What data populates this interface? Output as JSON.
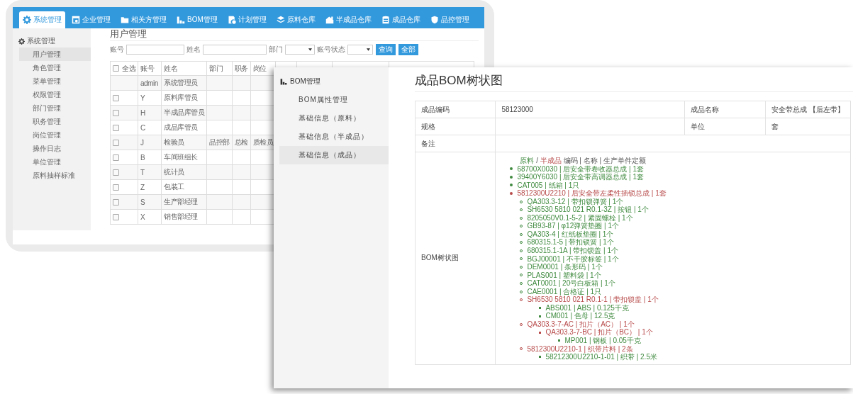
{
  "back_window": {
    "nav_tabs": [
      {
        "label": "系统管理",
        "selected": true
      },
      {
        "label": "企业管理",
        "selected": false
      },
      {
        "label": "相关方管理",
        "selected": false
      },
      {
        "label": "BOM管理",
        "selected": false
      },
      {
        "label": "计划管理",
        "selected": false
      },
      {
        "label": "原料仓库",
        "selected": false
      },
      {
        "label": "半成品仓库",
        "selected": false
      },
      {
        "label": "成品仓库",
        "selected": false
      },
      {
        "label": "品控管理",
        "selected": false
      }
    ],
    "sidebar": {
      "title": "系统管理",
      "items": [
        {
          "label": "用户管理",
          "selected": true
        },
        {
          "label": "角色管理",
          "selected": false
        },
        {
          "label": "菜单管理",
          "selected": false
        },
        {
          "label": "权限管理",
          "selected": false
        },
        {
          "label": "部门管理",
          "selected": false
        },
        {
          "label": "职务管理",
          "selected": false
        },
        {
          "label": "岗位管理",
          "selected": false
        },
        {
          "label": "操作日志",
          "selected": false
        },
        {
          "label": "单位管理",
          "selected": false
        },
        {
          "label": "原料抽样标准",
          "selected": false
        }
      ]
    },
    "page_title": "用户管理",
    "filters": [
      {
        "label": "账号",
        "kind": "text"
      },
      {
        "label": "姓名",
        "kind": "text"
      },
      {
        "label": "部门",
        "kind": "select"
      },
      {
        "label": "账号状态",
        "kind": "select"
      }
    ],
    "filter_buttons": [
      "查询",
      "全部"
    ],
    "table": {
      "select_all": {
        "label": "全选",
        "checked": false
      },
      "columns": [
        "账号",
        "姓名",
        "部门",
        "职务",
        "岗位"
      ],
      "rows": [
        {
          "kind": "fixed",
          "account": "admin",
          "name": "系统管理员"
        },
        {
          "kind": "checkable",
          "checked": false,
          "account": "Y",
          "name": "原料库管员"
        },
        {
          "kind": "checkable",
          "checked": false,
          "account": "H",
          "name": "半成品库管员"
        },
        {
          "kind": "checkable",
          "checked": false,
          "account": "C",
          "name": "成品库管员"
        },
        {
          "kind": "checkable",
          "checked": false,
          "account": "J",
          "name": "检验员",
          "dept": "品控部",
          "title": "总检",
          "post": "质检员"
        },
        {
          "kind": "checkable",
          "checked": false,
          "account": "B",
          "name": "车间班组长"
        },
        {
          "kind": "checkable",
          "checked": false,
          "account": "T",
          "name": "统计员"
        },
        {
          "kind": "checkable",
          "checked": false,
          "account": "Z",
          "name": "包装工"
        },
        {
          "kind": "checkable",
          "checked": false,
          "account": "S",
          "name": "生产部经理"
        },
        {
          "kind": "checkable",
          "checked": false,
          "account": "X",
          "name": "销售部经理"
        }
      ]
    }
  },
  "front_window": {
    "sidebar": {
      "title": "BOM管理",
      "items": [
        {
          "label": "BOM属性管理",
          "selected": false
        },
        {
          "label": "基础信息（原料）",
          "selected": false
        },
        {
          "label": "基础信息（半成品）",
          "selected": false
        },
        {
          "label": "基础信息（成品）",
          "selected": true
        }
      ]
    },
    "title": "成品BOM树状图",
    "fields": {
      "code": {
        "label": "成品编码",
        "value": "58123000"
      },
      "name": {
        "label": "成品名称",
        "value": "安全带总成 【后左带】"
      },
      "spec": {
        "label": "规格"
      },
      "unit": {
        "label": "单位",
        "value": "套"
      },
      "remark": {
        "label": "备注"
      },
      "tree_label": "BOM树状图"
    },
    "legend": {
      "raw": "原料",
      "separator": "/",
      "semi": "半成品",
      "rest": "编码 | 名称 | 生产单件定额"
    },
    "tree": [
      {
        "text": "68700X0030 | 后安全带卷收器总成 | 1套",
        "kind": "raw"
      },
      {
        "text": "39400Y6030 | 后安全带高调器总成 | 1套",
        "kind": "raw"
      },
      {
        "text": "CAT005 | 纸箱 | 1只",
        "kind": "raw"
      },
      {
        "text": "5812300U2210 | 后安全带左柔性插锁总成 | 1套",
        "kind": "semi",
        "children": [
          {
            "text": "QA303.3-12 | 带扣锁弹簧 | 1个",
            "kind": "raw"
          },
          {
            "text": "SH6530 5810 021 R0.1-3Z | 按钮 | 1个",
            "kind": "raw"
          },
          {
            "text": "8205050V0.1-5-2 | 紧固螺栓 | 1个",
            "kind": "raw"
          },
          {
            "text": "GB93-87 | φ12弹簧垫圈 | 1个",
            "kind": "raw"
          },
          {
            "text": "QA303-4 | 红纸板垫圈 | 1个",
            "kind": "raw"
          },
          {
            "text": "680315.1-5 | 带扣锁簧 | 1个",
            "kind": "raw"
          },
          {
            "text": "680315.1-1A | 带扣锁盖 | 1个",
            "kind": "raw"
          },
          {
            "text": "BGJ00001 | 不干胶标签 | 1个",
            "kind": "raw"
          },
          {
            "text": "DEM0001 | 条形码 | 1个",
            "kind": "raw"
          },
          {
            "text": "PLAS001 | 塑料袋 | 1个",
            "kind": "raw"
          },
          {
            "text": "CAT0001 | 20号白板箱 | 1个",
            "kind": "raw"
          },
          {
            "text": "CAE0001 | 合格证 | 1只",
            "kind": "raw"
          },
          {
            "text": "SH6530 5810 021 R0.1-1 | 带扣锁盖 | 1个",
            "kind": "semi",
            "children": [
              {
                "text": "ABS001 | ABS | 0.125千克",
                "kind": "raw"
              },
              {
                "text": "CM001 | 色母 | 12.5克",
                "kind": "raw"
              }
            ]
          },
          {
            "text": "QA303.3-7-AC | 扣片（AC） | 1个",
            "kind": "semi",
            "children": [
              {
                "text": "QA303.3-7-BC | 扣片（BC） | 1个",
                "kind": "semi",
                "children": [
                  {
                    "text": "MP001 | 钢板 | 0.05千克",
                    "kind": "raw"
                  }
                ]
              }
            ]
          },
          {
            "text": "5812300U2210-1 | 织带片料 | 2条",
            "kind": "semi",
            "children": [
              {
                "text": "58212300U2210-1-01 | 织带 | 2.5米",
                "kind": "raw"
              }
            ]
          }
        ]
      }
    ]
  }
}
